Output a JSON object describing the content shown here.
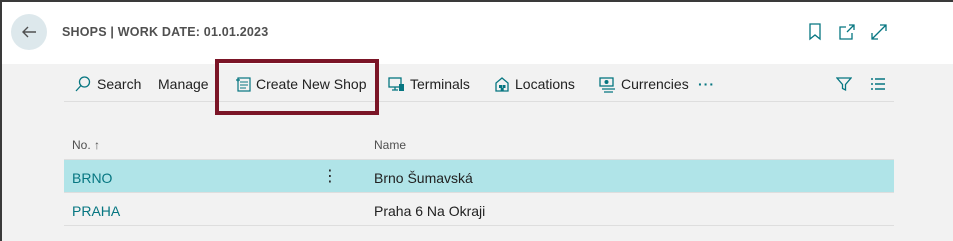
{
  "header": {
    "title": "SHOPS | WORK DATE: 01.01.2023"
  },
  "actions": {
    "search": "Search",
    "manage": "Manage",
    "create_new_shop": "Create New Shop",
    "terminals": "Terminals",
    "locations": "Locations",
    "currencies": "Currencies",
    "more": "···"
  },
  "grid": {
    "columns": {
      "no": "No. ↑",
      "name": "Name"
    },
    "rows": [
      {
        "no": "BRNO",
        "name": "Brno Šumavská"
      },
      {
        "no": "PRAHA",
        "name": "Praha 6 Na Okraji"
      }
    ],
    "row_menu": "⋮"
  },
  "colors": {
    "accent": "#067681",
    "selected_row": "#b0e4e8",
    "highlight_box": "#7b1527"
  }
}
